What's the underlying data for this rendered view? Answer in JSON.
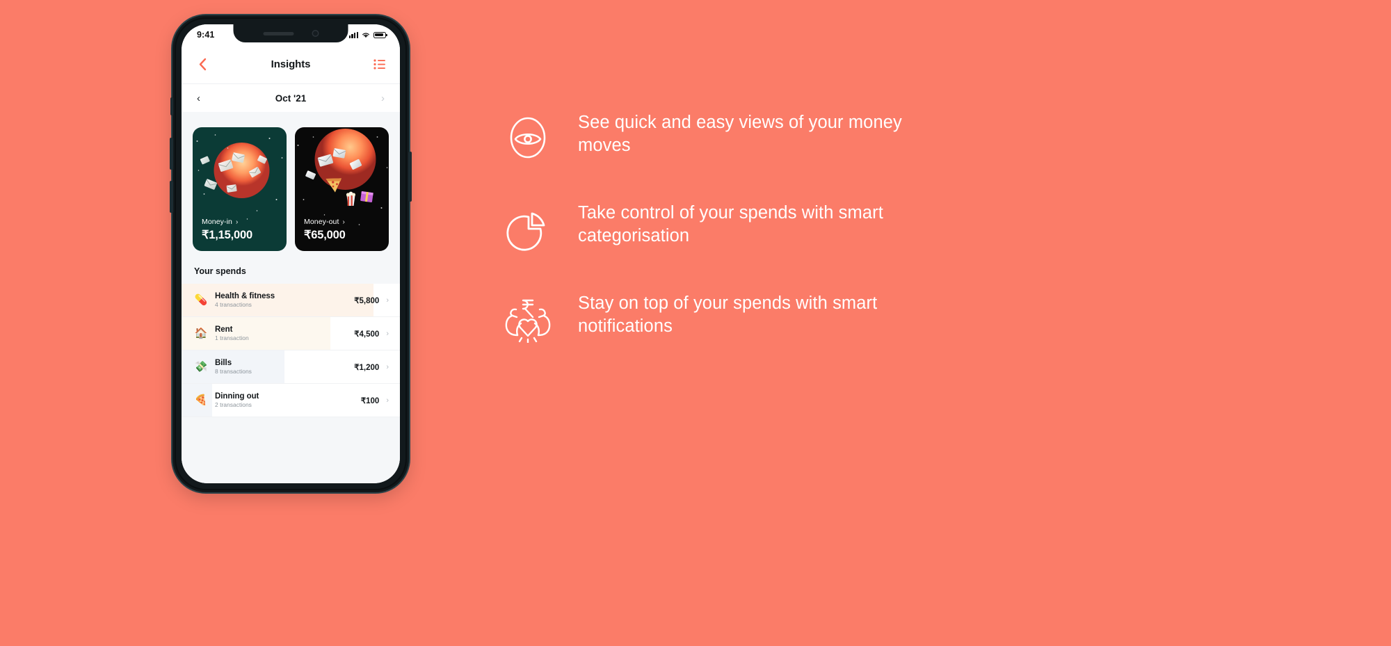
{
  "theme": {
    "background": "#fb7c68",
    "accent": "#ff6f5e",
    "card_in_bg": "#0b3b36",
    "card_out_bg": "#090909",
    "screen_bg": "#f5f7f9"
  },
  "phone": {
    "status": {
      "time": "9:41",
      "signal_icon": "cellular-signal-icon",
      "wifi_icon": "wifi-icon",
      "battery_icon": "battery-icon"
    },
    "nav": {
      "back_icon": "chevron-left-icon",
      "title": "Insights",
      "menu_icon": "list-menu-icon"
    },
    "month_switcher": {
      "prev_icon": "chevron-left-icon",
      "label": "Oct '21",
      "next_icon": "chevron-right-icon"
    },
    "cards": [
      {
        "id": "money-in",
        "label": "Money-in",
        "arrow": "›",
        "amount": "₹1,15,000",
        "bg": "#0b3b36"
      },
      {
        "id": "money-out",
        "label": "Money-out",
        "arrow": "›",
        "amount": "₹65,000",
        "bg": "#090909"
      }
    ],
    "spends": {
      "heading": "Your spends",
      "chevron": "›",
      "items": [
        {
          "emoji": "💊",
          "emoji_name": "pill-icon",
          "name": "Health & fitness",
          "transactions": "4 transactions",
          "amount": "₹5,800",
          "fill_pct": 88,
          "fill_color": "#fdf3ea"
        },
        {
          "emoji": "🏠",
          "emoji_name": "house-icon",
          "name": "Rent",
          "transactions": "1 transaction",
          "amount": "₹4,500",
          "fill_pct": 68,
          "fill_color": "#fdf8ef"
        },
        {
          "emoji": "💸",
          "emoji_name": "money-with-wings-icon",
          "name": "Bills",
          "transactions": "8 transactions",
          "amount": "₹1,200",
          "fill_pct": 47,
          "fill_color": "#f2f5f9"
        },
        {
          "emoji": "🍕",
          "emoji_name": "pizza-icon",
          "name": "Dinning out",
          "transactions": "2 transactions",
          "amount": "₹100",
          "fill_pct": 14,
          "fill_color": "#f2f5f9"
        }
      ]
    }
  },
  "features": [
    {
      "icon": "eye-icon",
      "text": "See quick and easy views of your money moves"
    },
    {
      "icon": "pie-chart-icon",
      "text": "Take control of your spends with smart categorisation"
    },
    {
      "icon": "flexing-arms-rupee-heart-icon",
      "text": "Stay on top of your spends with smart notifications"
    }
  ]
}
